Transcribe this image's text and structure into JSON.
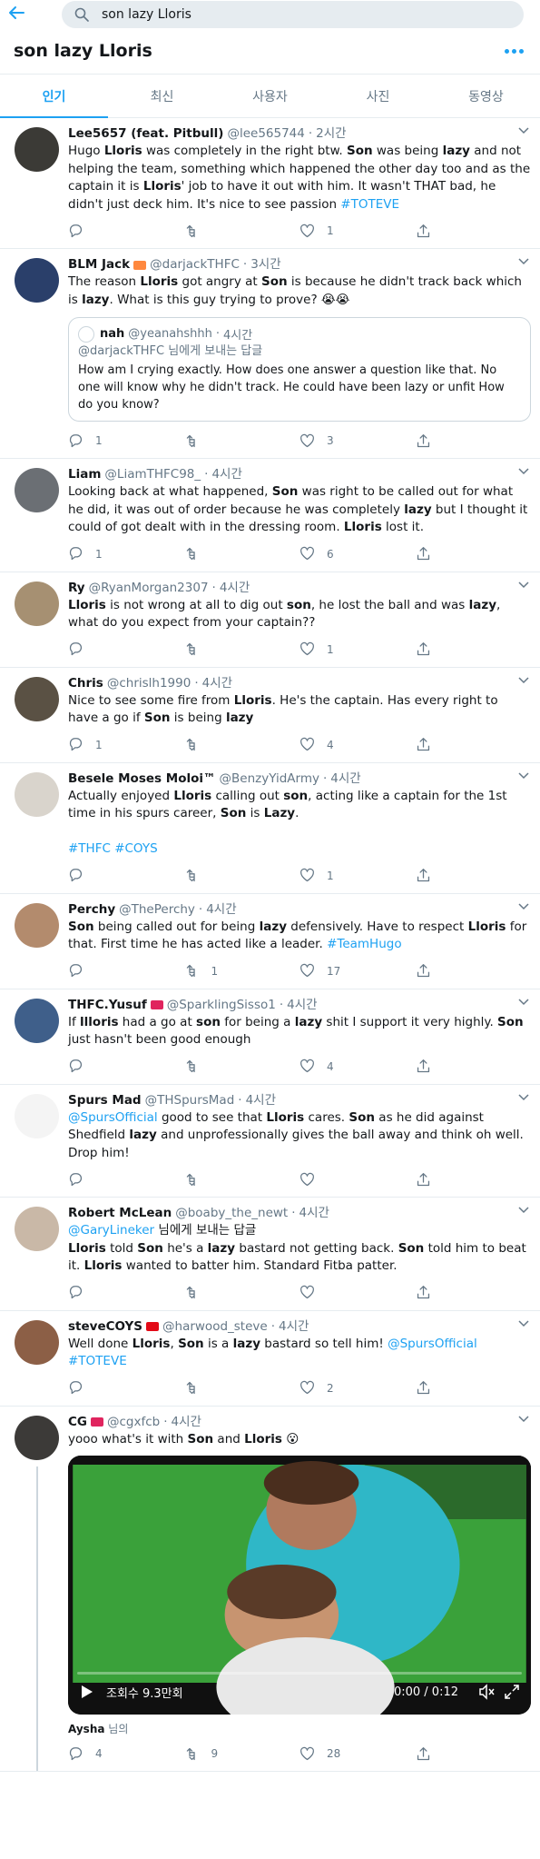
{
  "search": {
    "query": "son lazy Lloris"
  },
  "header": {
    "title": "son lazy Lloris"
  },
  "tabs": [
    {
      "label": "인기"
    },
    {
      "label": "최신"
    },
    {
      "label": "사용자"
    },
    {
      "label": "사진"
    },
    {
      "label": "동영상"
    }
  ],
  "colors": {
    "accent": "#1da1f2",
    "text": "#14171a",
    "muted": "#657786",
    "border": "#e6ecf0"
  },
  "tweets": [
    {
      "author": "Lee5657 (feat. Pitbull)",
      "handle": "@lee565744",
      "time": "2시간",
      "segs": [
        [
          "Hugo ",
          0
        ],
        [
          "Lloris",
          1
        ],
        [
          " was completely in the right btw. ",
          0
        ],
        [
          "Son",
          1
        ],
        [
          " was being ",
          0
        ],
        [
          "lazy",
          1
        ],
        [
          " and not helping the team, something which happened the other day too and as the captain it is ",
          0
        ],
        [
          "Lloris",
          1
        ],
        [
          "' job to have it out with him. It wasn't THAT bad, he didn't just deck him. It's nice to see passion ",
          0
        ],
        [
          "#TOTEVE",
          2
        ]
      ],
      "replies": "",
      "retweets": "",
      "likes": "1"
    },
    {
      "author": "BLM Jack",
      "flag": true,
      "handle": "@darjackTHFC",
      "time": "3시간",
      "segs": [
        [
          "The reason ",
          0
        ],
        [
          "Lloris",
          1
        ],
        [
          " got angry at ",
          0
        ],
        [
          "Son",
          1
        ],
        [
          " is because he didn't track back which is ",
          0
        ],
        [
          "lazy",
          1
        ],
        [
          ". What is this guy trying to prove? 😭😭",
          0
        ]
      ],
      "quote": {
        "author": "nah",
        "handle": "@yeanahshhh",
        "time": "4시간",
        "reply_to": "@darjackTHFC 님에게 보내는 답글",
        "text": "How am I crying exactly. How does one answer a question like that. No one will know why he didn't track.  He could have been lazy or unfit   How do you know?"
      },
      "replies": "1",
      "retweets": "",
      "likes": "3"
    },
    {
      "author": "Liam",
      "handle": "@LiamTHFC98_",
      "time": "4시간",
      "segs": [
        [
          "Looking back at what happened, ",
          0
        ],
        [
          "Son",
          1
        ],
        [
          " was right to be called out for what he did, it was out of order because he was completely ",
          0
        ],
        [
          "lazy",
          1
        ],
        [
          " but I thought it could of got dealt with in the dressing room. ",
          0
        ],
        [
          "Lloris",
          1
        ],
        [
          " lost it.",
          0
        ]
      ],
      "replies": "1",
      "retweets": "",
      "likes": "6"
    },
    {
      "author": "Ry",
      "handle": "@RyanMorgan2307",
      "time": "4시간",
      "segs": [
        [
          "Lloris",
          1
        ],
        [
          " is not wrong at all to dig out ",
          0
        ],
        [
          "son",
          1
        ],
        [
          ", he lost the ball and was ",
          0
        ],
        [
          "lazy",
          1
        ],
        [
          ", what do you expect from your captain??",
          0
        ]
      ],
      "replies": "",
      "retweets": "",
      "likes": "1"
    },
    {
      "author": "Chris",
      "handle": "@chrislh1990",
      "time": "4시간",
      "segs": [
        [
          "Nice to see some fire from ",
          0
        ],
        [
          "Lloris",
          1
        ],
        [
          ". He's the captain. Has every right to have a go if ",
          0
        ],
        [
          "Son",
          1
        ],
        [
          " is being ",
          0
        ],
        [
          "lazy",
          1
        ]
      ],
      "replies": "1",
      "retweets": "",
      "likes": "4"
    },
    {
      "author": "Besele Moses Moloi™",
      "handle": "@BenzyYidArmy",
      "time": "4시간",
      "segs": [
        [
          "Actually enjoyed ",
          0
        ],
        [
          "Lloris",
          1
        ],
        [
          " calling out ",
          0
        ],
        [
          "son",
          1
        ],
        [
          ", acting like a captain for the 1st time in his spurs career, ",
          0
        ],
        [
          "Son",
          1
        ],
        [
          " is ",
          0
        ],
        [
          "Lazy",
          1
        ],
        [
          ".",
          0
        ],
        [
          "\n\n",
          0
        ],
        [
          "#THFC #COYS",
          2
        ]
      ],
      "replies": "",
      "retweets": "",
      "likes": "1"
    },
    {
      "author": "Perchy",
      "handle": "@ThePerchy",
      "time": "4시간",
      "segs": [
        [
          "Son",
          1
        ],
        [
          " being called out for being ",
          0
        ],
        [
          "lazy",
          1
        ],
        [
          " defensively. Have to respect ",
          0
        ],
        [
          "Lloris",
          1
        ],
        [
          " for that. First time he has acted like a leader. ",
          0
        ],
        [
          "#TeamHugo",
          2
        ]
      ],
      "replies": "",
      "retweets": "1",
      "likes": "17"
    },
    {
      "author": "THFC.Yusuf",
      "flag": true,
      "handle": "@SparklingSisso1",
      "time": "4시간",
      "segs": [
        [
          "If ",
          0
        ],
        [
          "llloris",
          1
        ],
        [
          " had a go at ",
          0
        ],
        [
          "son",
          1
        ],
        [
          " for being a ",
          0
        ],
        [
          "lazy",
          1
        ],
        [
          " shit I support it very highly. ",
          0
        ],
        [
          "Son",
          1
        ],
        [
          " just hasn't been good enough",
          0
        ]
      ],
      "replies": "",
      "retweets": "",
      "likes": "4"
    },
    {
      "author": "Spurs Mad",
      "handle": "@THSpursMad",
      "time": "4시간",
      "segs": [
        [
          "@SpursOfficial",
          2
        ],
        [
          " good to see that ",
          0
        ],
        [
          "Lloris",
          1
        ],
        [
          " cares. ",
          0
        ],
        [
          "Son",
          1
        ],
        [
          " as he did against Shedfield ",
          0
        ],
        [
          "lazy",
          1
        ],
        [
          " and unprofessionally gives the ball away and think oh well. Drop him!",
          0
        ]
      ],
      "replies": "",
      "retweets": "",
      "likes": ""
    },
    {
      "author": "Robert McLean",
      "handle": "@boaby_the_newt",
      "time": "4시간",
      "segs": [
        [
          "@GaryLineker",
          2
        ],
        [
          " 님에게 보내는 답글",
          0
        ],
        [
          "\n",
          0
        ],
        [
          "Lloris",
          1
        ],
        [
          " told ",
          0
        ],
        [
          "Son",
          1
        ],
        [
          " he's a ",
          0
        ],
        [
          "lazy",
          1
        ],
        [
          " bastard not getting back. ",
          0
        ],
        [
          "Son",
          1
        ],
        [
          " told him to beat it. ",
          0
        ],
        [
          "Lloris",
          1
        ],
        [
          " wanted to batter him. Standard Fitba patter.",
          0
        ]
      ],
      "replies": "",
      "retweets": "",
      "likes": ""
    },
    {
      "author": "steveCOYS",
      "flag": true,
      "handle": "@harwood_steve",
      "time": "4시간",
      "segs": [
        [
          "Well done ",
          0
        ],
        [
          "Lloris",
          1
        ],
        [
          ", ",
          0
        ],
        [
          "Son",
          1
        ],
        [
          " is a ",
          0
        ],
        [
          "lazy",
          1
        ],
        [
          " bastard so tell him! ",
          0
        ],
        [
          "@SpursOfficial",
          2
        ],
        [
          "\n",
          0
        ],
        [
          "#TOTEVE",
          2
        ]
      ],
      "replies": "",
      "retweets": "",
      "likes": "2"
    },
    {
      "author": "CG",
      "flag": true,
      "handle": "@cgxfcb",
      "time": "4시간",
      "segs": [
        [
          "yooo what's it with ",
          0
        ],
        [
          "Son",
          1
        ],
        [
          " and ",
          0
        ],
        [
          "Lloris",
          1
        ],
        [
          " 😮",
          0
        ]
      ],
      "video": {
        "views": "조회수 9.3만회",
        "duration": "0:00 / 0:12",
        "progress": 0
      },
      "replied_by": {
        "name": "Aysha",
        "suffix": " 님의"
      },
      "replies": "4",
      "retweets": "9",
      "likes": "28"
    }
  ]
}
